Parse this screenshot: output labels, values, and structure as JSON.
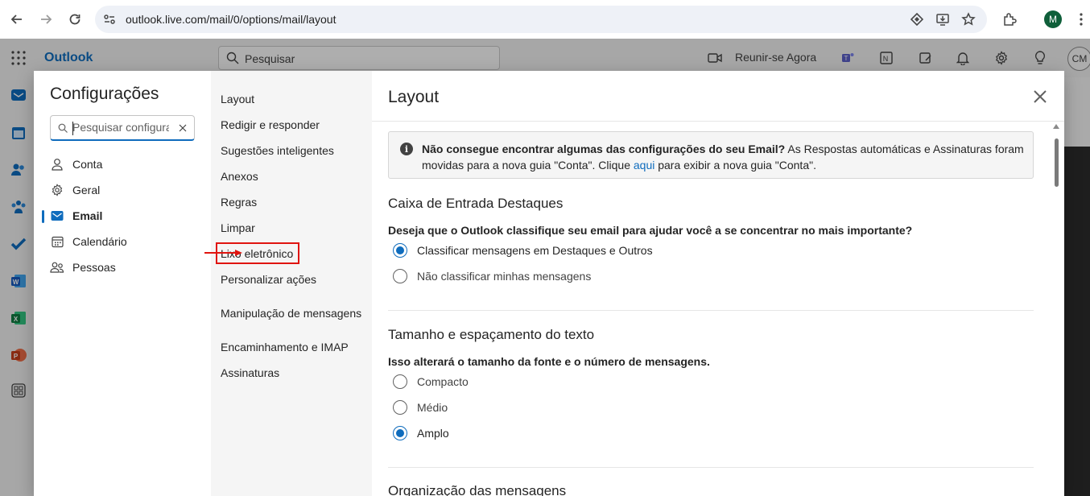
{
  "browser": {
    "url": "outlook.live.com/mail/0/options/mail/layout",
    "profile_initial": "M"
  },
  "app": {
    "brand": "Outlook",
    "search_label": "Pesquisar",
    "meet_now": "Reunir-se Agora",
    "avatar_initials": "CM"
  },
  "settings": {
    "title": "Configurações",
    "search_placeholder": "Pesquisar configurações",
    "categories": [
      {
        "label": "Conta",
        "icon": "person-icon"
      },
      {
        "label": "Geral",
        "icon": "gear-icon"
      },
      {
        "label": "Email",
        "icon": "mail-icon",
        "active": true
      },
      {
        "label": "Calendário",
        "icon": "calendar-icon"
      },
      {
        "label": "Pessoas",
        "icon": "people-icon"
      }
    ],
    "email_subsections": [
      "Layout",
      "Redigir e responder",
      "Sugestões inteligentes",
      "Anexos",
      "Regras",
      "Limpar",
      "Lixo eletrônico",
      "Personalizar ações",
      "Manipulação de mensagens",
      "Encaminhamento e IMAP",
      "Assinaturas"
    ],
    "highlighted_subsection": "Lixo eletrônico"
  },
  "layout_panel": {
    "title": "Layout",
    "info": {
      "bold": "Não consegue encontrar algumas das configurações do seu Email?",
      "text1": " As Respostas automáticas e Assinaturas foram movidas para a nova guia \"Conta\". Clique ",
      "link": "aqui",
      "text2": " para exibir a nova guia \"Conta\"."
    },
    "focused_inbox": {
      "title": "Caixa de Entrada Destaques",
      "question": "Deseja que o Outlook classifique seu email para ajudar você a se concentrar no mais importante?",
      "options": [
        "Classificar mensagens em Destaques e Outros",
        "Não classificar minhas mensagens"
      ],
      "selected": 0
    },
    "text_size": {
      "title": "Tamanho e espaçamento do texto",
      "question": "Isso alterará o tamanho da fonte e o número de mensagens.",
      "options": [
        "Compacto",
        "Médio",
        "Amplo"
      ],
      "selected": 2
    },
    "organization": {
      "title": "Organização das mensagens"
    }
  },
  "colors": {
    "accent": "#0f6cbd",
    "highlight_box": "#e0140f"
  }
}
